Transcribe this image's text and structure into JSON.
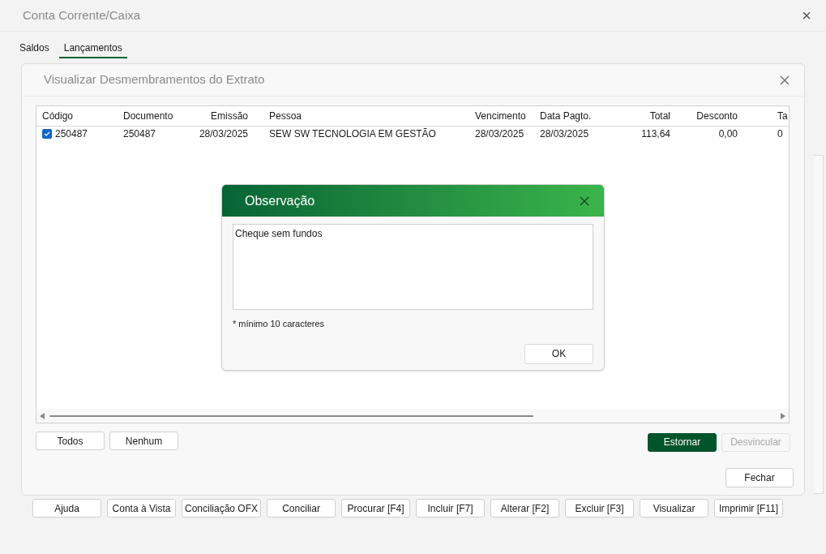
{
  "window": {
    "title": "Conta Corrente/Caixa",
    "close": "×"
  },
  "tabs": [
    {
      "label": "Saldos",
      "selected": false
    },
    {
      "label": "Lançamentos",
      "selected": true
    }
  ],
  "panel": {
    "title": "Visualizar Desmembramentos do Extrato",
    "table": {
      "columns": [
        {
          "label": "Código",
          "kind": "text"
        },
        {
          "label": "Documento",
          "kind": "text"
        },
        {
          "label": "Emissão",
          "kind": "number"
        },
        {
          "label": "Pessoa",
          "kind": "text"
        },
        {
          "label": "Vencimento",
          "kind": "text"
        },
        {
          "label": "Data Pagto.",
          "kind": "text"
        },
        {
          "label": "Total",
          "kind": "number"
        },
        {
          "label": "Desconto",
          "kind": "number"
        },
        {
          "label": "Ta",
          "kind": "text"
        }
      ],
      "rows": [
        {
          "checked": true,
          "cells": [
            "250487",
            "250487",
            "28/03/2025",
            "SEW SW TECNOLOGIA EM GESTÃO",
            "28/03/2025",
            "28/03/2025",
            "113,64",
            "0,00",
            "0"
          ]
        }
      ]
    },
    "left_buttons": [
      {
        "label": "Todos",
        "disabled": false
      },
      {
        "label": "Nenhum",
        "disabled": false
      }
    ],
    "right_buttons": [
      {
        "label": "Estornar",
        "disabled": false,
        "kind": "primary"
      },
      {
        "label": "Desvincular",
        "disabled": true,
        "kind": "normal"
      }
    ],
    "close_button": "Fechar"
  },
  "toolbar": [
    "Ajuda",
    "Conta à Vista",
    "Conciliação OFX",
    "Conciliar",
    "Procurar [F4]",
    "Incluir [F7]",
    "Alterar [F2]",
    "Excluir [F3]",
    "Visualizar",
    "Imprimir [F11]"
  ],
  "dialog": {
    "title": "Observação",
    "value": "Cheque sem fundos",
    "note": "* mínimo 10 caracteres",
    "ok": "OK"
  }
}
